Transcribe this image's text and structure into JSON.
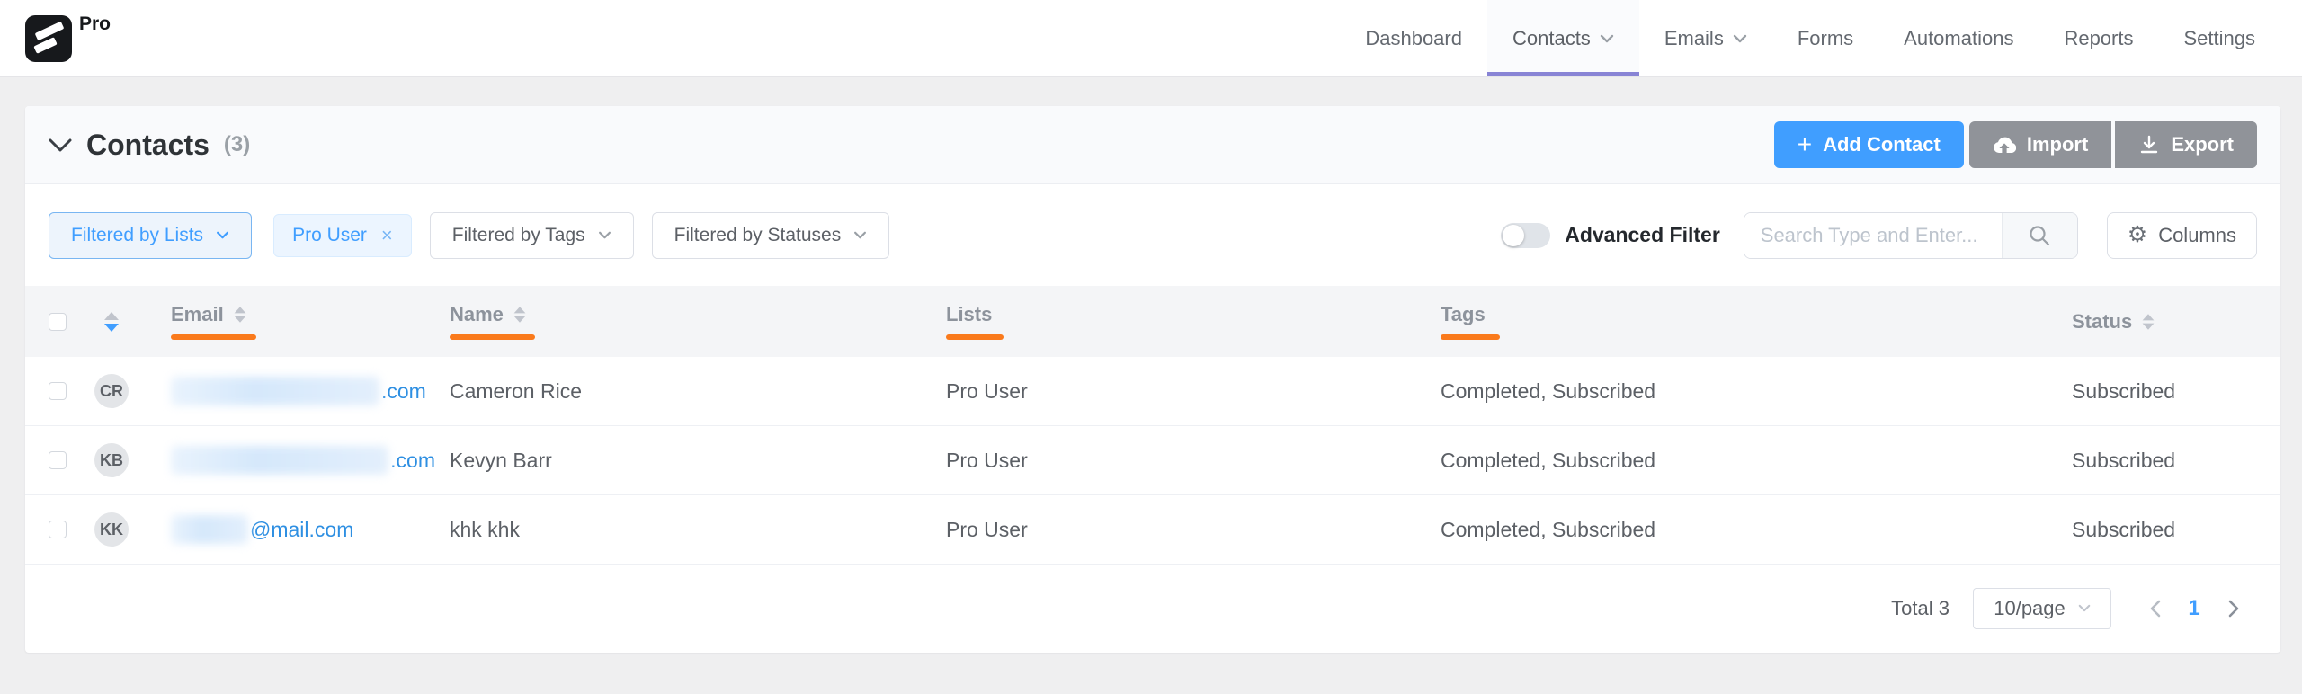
{
  "brand": {
    "badge": "Pro"
  },
  "nav": {
    "items": [
      {
        "label": "Dashboard"
      },
      {
        "label": "Contacts",
        "has_dropdown": true,
        "active": true
      },
      {
        "label": "Emails",
        "has_dropdown": true
      },
      {
        "label": "Forms"
      },
      {
        "label": "Automations"
      },
      {
        "label": "Reports"
      },
      {
        "label": "Settings"
      }
    ]
  },
  "header": {
    "title": "Contacts",
    "count": "(3)",
    "add_contact_label": "Add Contact",
    "add_contact_plus": "+",
    "import_label": "Import",
    "export_label": "Export"
  },
  "filters": {
    "lists_label": "Filtered by Lists",
    "applied_list_tag": "Pro User",
    "tag_close": "×",
    "tags_label": "Filtered by Tags",
    "statuses_label": "Filtered by Statuses",
    "advanced_filter_label": "Advanced Filter",
    "advanced_filter_enabled": false,
    "search_placeholder": "Search Type and Enter...",
    "columns_label": "Columns",
    "gear_glyph": "⚙"
  },
  "table": {
    "columns": {
      "email": "Email",
      "name": "Name",
      "lists": "Lists",
      "tags": "Tags",
      "status": "Status"
    },
    "rows": [
      {
        "initials": "CR",
        "email_visible": ".com",
        "name": "Cameron Rice",
        "lists": "Pro User",
        "tags": "Completed, Subscribed",
        "status": "Subscribed"
      },
      {
        "initials": "KB",
        "email_visible": ".com",
        "name": "Kevyn Barr",
        "lists": "Pro User",
        "tags": "Completed, Subscribed",
        "status": "Subscribed"
      },
      {
        "initials": "KK",
        "email_visible": "@mail.com",
        "name": "khk khk",
        "lists": "Pro User",
        "tags": "Completed, Subscribed",
        "status": "Subscribed"
      }
    ]
  },
  "pagination": {
    "total_label": "Total 3",
    "page_size": "10/page",
    "current_page": "1"
  },
  "colors": {
    "primary_blue": "#409eff",
    "info_button_gray": "#909399",
    "accent_orange": "#fa7a1c",
    "active_tab_underline": "#8884d5",
    "email_link_blue": "#2e8fe2",
    "page_background": "#efeff0"
  }
}
